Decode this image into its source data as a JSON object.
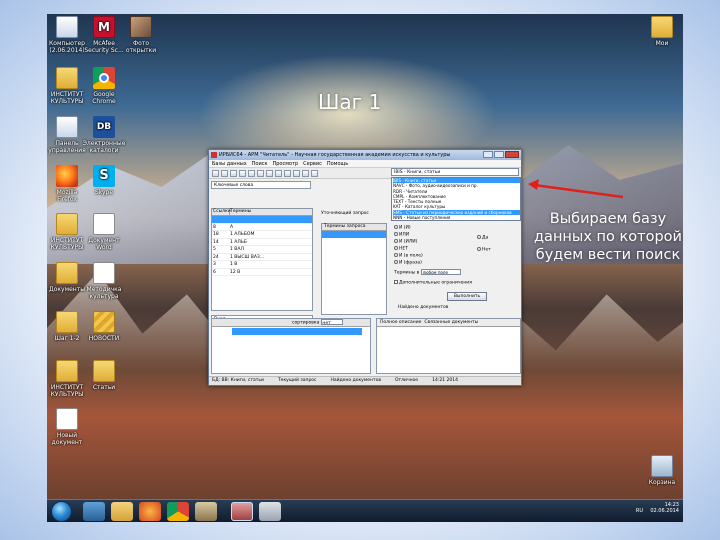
{
  "slide": {
    "step_title": "Шаг 1",
    "callout": "Выбираем базу данных по которой будем вести поиск",
    "arrow_color": "#e0201a"
  },
  "desktop_icons": [
    {
      "id": "computer",
      "label": "Компьютер\n(2.06.2014)",
      "icon": "computer-icon"
    },
    {
      "id": "mcafee",
      "label": "McAfee\nSecurity Sc...",
      "icon": "mcafee-icon"
    },
    {
      "id": "pic",
      "label": "Фото\nоткрытки",
      "icon": "picture-icon"
    },
    {
      "id": "folder1",
      "label": "ИНСТИТУТ\nКУЛЬТУРЫ",
      "icon": "folder-icon"
    },
    {
      "id": "chrome",
      "label": "Google\nChrome",
      "icon": "chrome-icon"
    },
    {
      "id": "pannel",
      "label": "Панель\nуправления",
      "icon": "control-panel-icon"
    },
    {
      "id": "db",
      "label": "Электронные\nкаталоги",
      "icon": "db-icon"
    },
    {
      "id": "firefox",
      "label": "Mozilla\nFirefox",
      "icon": "firefox-icon"
    },
    {
      "id": "skype",
      "label": "Skype",
      "icon": "skype-icon"
    },
    {
      "id": "folder2",
      "label": "ИНСТИТУТ\nКУЛЬТУРЫ",
      "icon": "folder-icon"
    },
    {
      "id": "doc1",
      "label": "Документ\nWord",
      "icon": "document-icon"
    },
    {
      "id": "folder3",
      "label": "Документы",
      "icon": "folder-icon"
    },
    {
      "id": "doc2",
      "label": "Методичка\nкультура",
      "icon": "document-icon"
    },
    {
      "id": "folder4",
      "label": "Шаг 1-2",
      "icon": "folder-icon"
    },
    {
      "id": "stripe",
      "label": "НОВОСТИ",
      "icon": "archive-icon"
    },
    {
      "id": "folder5",
      "label": "ИНСТИТУТ\nКУЛЬТУРЫ",
      "icon": "folder-icon"
    },
    {
      "id": "folder6",
      "label": "Статьи",
      "icon": "folder-icon"
    },
    {
      "id": "doc3",
      "label": "Новый\nдокумент",
      "icon": "document-icon"
    },
    {
      "id": "folder_tr",
      "label": "Мои",
      "icon": "folder-icon"
    },
    {
      "id": "recycle",
      "label": "Корзина",
      "icon": "recycle-bin-icon"
    }
  ],
  "app": {
    "title": "ИРБИС64 - АРМ \"Читатель\" - Научная государственная академия искусства и культуры",
    "menu": [
      "Базы данных",
      "Поиск",
      "Просмотр",
      "Сервис",
      "Помощь"
    ],
    "db_selected": "IBIS - Книги, статьи",
    "db_options": [
      "IBIS - Книги, статьи",
      "NAVC - Фото, аудио-видеозаписи и пр.",
      "RDR - Читатели",
      "CMPL - Комплектование",
      "TEXT - Тексты полные",
      "KAT - Каталог культуры",
      "SMS - Статьи из периодических изданий и сборников",
      "NNN - Новые поступления"
    ],
    "left_top_value": "Ключевые слова",
    "left_grid_head": [
      "Ссылки",
      "Термины"
    ],
    "left_rows": [
      {
        "n": "",
        "t": ""
      },
      {
        "n": "8",
        "t": "А"
      },
      {
        "n": "18",
        "t": "1 АЛЬБОМ"
      },
      {
        "n": "14",
        "t": "1 АЛЬБ"
      },
      {
        "n": "5",
        "t": "1 ВАЛ"
      },
      {
        "n": "24",
        "t": "1 ВЫСШ ВАЗ..."
      },
      {
        "n": "3",
        "t": "1 В"
      },
      {
        "n": "6",
        "t": "12 В"
      }
    ],
    "left_bottom_label": "Вход",
    "mid_label": "Уточняющий запрос",
    "mid_head": "Термины запроса",
    "right": {
      "logic_and": "И (И)",
      "logic_options": [
        "ИЛИ",
        "И (ИЛИ)",
        "НЕТ",
        "И (в поле)",
        "И (фраза)"
      ],
      "truncation_label": "Да",
      "truncation_no": "Нет",
      "terms_label": "Термины в",
      "terms_select": "любом поле",
      "extra_check": "Дополнительные ограничения",
      "execute_button": "Выполнить"
    },
    "found_label": "Найдено документов",
    "bottom": {
      "sort_label": "сортировка",
      "sort_value": "нет",
      "tab1": "Полное описание",
      "tab2": "Связанные документы"
    },
    "status": {
      "base": "БД: ВВ: Книги, статьи",
      "current": "Текущий запрос",
      "found": "Найдено документов",
      "mode": "Отличное",
      "time": "14:21 2014"
    }
  },
  "taskbar": {
    "tasks": [
      "explorer",
      "ie",
      "folder",
      "firefox",
      "chrome",
      "tool",
      "irbis",
      "settings"
    ],
    "tray_text": "RU",
    "clock_time": "14:23",
    "clock_date": "02.06.2014"
  }
}
